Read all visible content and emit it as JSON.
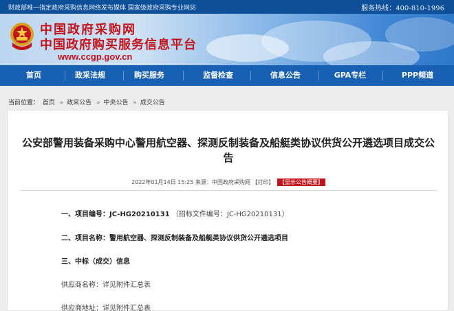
{
  "topbar": {
    "left_text": "财政部唯一指定政府采购信息网络发布媒体  国家级政府采购专业网站",
    "hotline_label": "服务热线：",
    "hotline_number": "400-810-1996"
  },
  "site": {
    "name_line1": "中国政府采购网",
    "name_line2": "中国政府购买服务信息平台",
    "url": "www.ccgp.gov.cn"
  },
  "nav": {
    "items": [
      "首页",
      "政采法规",
      "购买服务",
      "监督检查",
      "信息公告",
      "GPA专栏",
      "PPP频道"
    ]
  },
  "breadcrumb": {
    "prefix": "当前位置：",
    "items": [
      "首页",
      "政采公告",
      "中央公告",
      "成交公告"
    ],
    "separator": "»"
  },
  "article": {
    "title": "公安部警用装备采购中心警用航空器、探测反制装备及船艇类协议供货公开遴选项目成交公告",
    "date": "2022年01月14日 15:25",
    "source_label": "来源：",
    "source": "中国政府采购网",
    "print_label": "【打印】",
    "summary_badge": "【显示公告概要】",
    "sections": [
      {
        "label": "一、项目编号：",
        "value": "JC-HG20210131",
        "note": "（招标文件编号：JC-HG20210131）"
      },
      {
        "label": "二、项目名称：",
        "value": "警用航空器、探测反制装备及船艇类协议供货公开遴选项目",
        "note": ""
      },
      {
        "label": "三、中标（成交）信息",
        "value": "",
        "note": ""
      },
      {
        "label": "供应商名称：",
        "value": "详见附件汇总表",
        "note": ""
      },
      {
        "label": "供应商地址：",
        "value": "详见附件汇总表",
        "note": ""
      }
    ]
  },
  "colors": {
    "topbar": "#0d4f98",
    "nav": "#1760b3",
    "brand_red": "#c4141b"
  }
}
